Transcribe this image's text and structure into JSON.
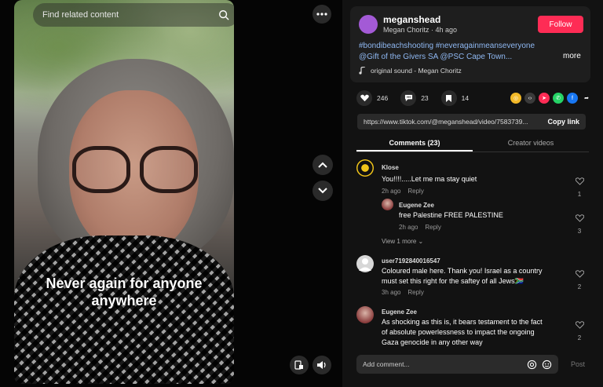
{
  "search": {
    "placeholder": "Find related content"
  },
  "video": {
    "caption_line1": "Never again for anyone",
    "caption_line2": "anywhere"
  },
  "post": {
    "username": "meganshead",
    "author": "Megan Choritz",
    "time_ago": "4h ago",
    "follow_label": "Follow",
    "description_line1": "#bondibeachshooting #neveragainmeanseveryone",
    "description_line2": "@Gift of the Givers SA @PSC Cape Town...",
    "more_label": "more",
    "sound": "original sound - Megan Choritz"
  },
  "actions": {
    "likes": "246",
    "comments": "23",
    "saves": "14"
  },
  "link": {
    "url": "https://www.tiktok.com/@meganshead/video/7583739...",
    "copy_label": "Copy link"
  },
  "tabs": [
    {
      "label": "Comments (23)"
    },
    {
      "label": "Creator videos"
    }
  ],
  "comments": [
    {
      "user": "Klose",
      "text": "You!!!!.....Let me ma stay quiet",
      "time": "2h ago",
      "reply": "Reply",
      "likes": "1"
    },
    {
      "user": "Eugene Zee",
      "text": "free Palestine FREE PALESTINE",
      "time": "2h ago",
      "reply": "Reply",
      "likes": "3"
    },
    {
      "user": "user7192840016547",
      "text_line1": "Coloured male here. Thank you! Israel as a country",
      "text_line2": "must set this right for the saftey of all Jews🇿🇦",
      "time": "3h ago",
      "reply": "Reply",
      "likes": "2"
    },
    {
      "user": "Eugene Zee",
      "text_line1": "As shocking as this is, it bears testament to the fact",
      "text_line2": "of absolute powerlessness to impact the ongoing",
      "text_line3": "Gaza genocide in any other way",
      "likes": "2"
    }
  ],
  "view_more": "View 1 more",
  "composer": {
    "placeholder": "Add comment...",
    "post_label": "Post"
  },
  "colors": {
    "follow": "#fe2c55",
    "hashtag": "#8fb8f2",
    "avatar": "#a35ad6"
  }
}
